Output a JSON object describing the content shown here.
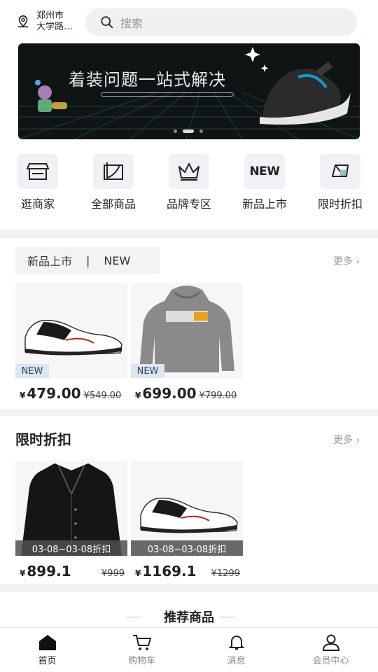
{
  "header": {
    "location": "郑州市\n大学路…",
    "search_placeholder": "搜索"
  },
  "banner": {
    "title": "着装问题一站式解决"
  },
  "categories": [
    {
      "label": "逛商家",
      "icon": "store-icon"
    },
    {
      "label": "全部商品",
      "icon": "bag-icon"
    },
    {
      "label": "品牌专区",
      "icon": "crown-icon"
    },
    {
      "label": "新品上市",
      "icon": "new-icon",
      "icon_text": "NEW"
    },
    {
      "label": "限时折扣",
      "icon": "tag-icon"
    }
  ],
  "new_arrivals": {
    "tag_label": "新品上市",
    "tag_divider": "|",
    "tag_en": "NEW",
    "more": "更多 ›",
    "badge": "NEW",
    "items": [
      {
        "yen": "¥",
        "price": "479.00",
        "orig": "¥549.00"
      },
      {
        "yen": "¥",
        "price": "699.00",
        "orig": "¥799.00"
      }
    ]
  },
  "discount": {
    "title": "限时折扣",
    "more": "更多 ›",
    "items": [
      {
        "date": "03-08~03-08折扣",
        "yen": "¥",
        "price": "899.1",
        "orig": "¥999"
      },
      {
        "date": "03-08~03-08折扣",
        "yen": "¥",
        "price": "1169.1",
        "orig": "¥1299"
      }
    ]
  },
  "recommend": {
    "title": "推荐商品"
  },
  "tabbar": [
    {
      "label": "首页",
      "icon": "home-icon",
      "active": true
    },
    {
      "label": "购物车",
      "icon": "cart-icon"
    },
    {
      "label": "消息",
      "icon": "bell-icon"
    },
    {
      "label": "会员中心",
      "icon": "user-icon"
    }
  ]
}
